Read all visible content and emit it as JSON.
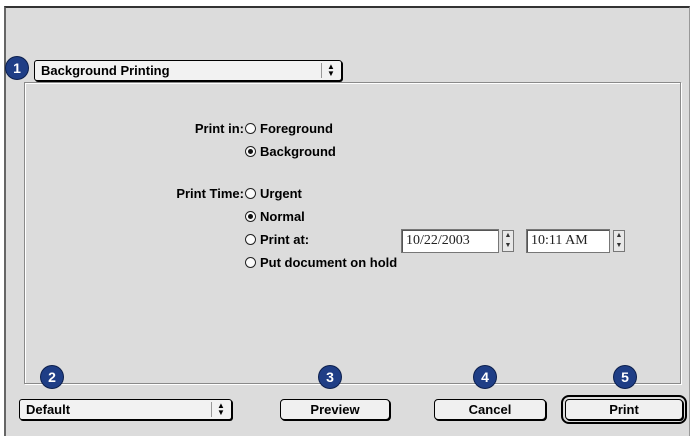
{
  "dialog": {
    "panel_popup": {
      "label": "Background Printing",
      "icon": "updown-arrows-icon"
    },
    "print_in": {
      "label": "Print in:",
      "options": [
        {
          "label": "Foreground",
          "selected": false
        },
        {
          "label": "Background",
          "selected": true
        }
      ]
    },
    "print_time": {
      "label": "Print Time:",
      "options": [
        {
          "label": "Urgent",
          "selected": false
        },
        {
          "label": "Normal",
          "selected": true
        },
        {
          "label": "Print at:",
          "selected": false
        },
        {
          "label": "Put document on hold",
          "selected": false
        }
      ],
      "date_value": "10/22/2003",
      "time_value": "10:11 AM"
    },
    "preset_popup": {
      "label": "Default"
    },
    "buttons": {
      "preview": "Preview",
      "cancel": "Cancel",
      "print": "Print"
    }
  },
  "callouts": [
    "1",
    "2",
    "3",
    "4",
    "5"
  ],
  "colors": {
    "callout_badge": "#1f3e86",
    "dialog_bg": "#dcdcdc"
  }
}
